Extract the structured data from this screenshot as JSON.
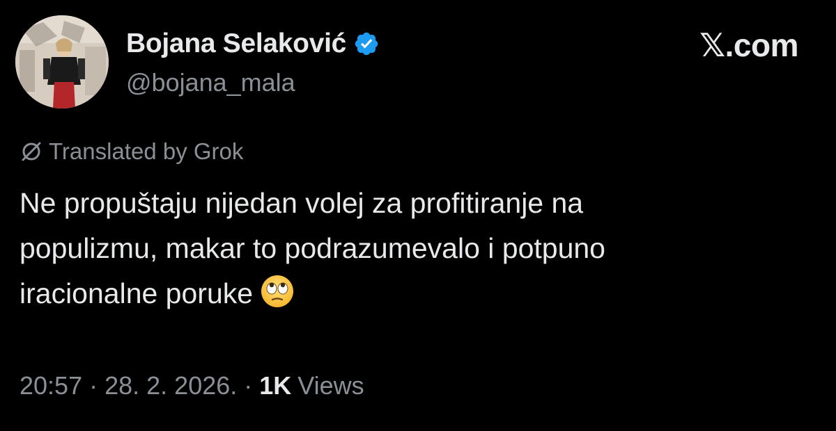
{
  "site_mark": "𝕏.com",
  "author": {
    "display_name": "Bojana Selaković",
    "handle": "@bojana_mala",
    "verified": true,
    "badge_color": "#1d9bf0"
  },
  "tweet": {
    "translation_note": "Translated by Grok",
    "lines": [
      "Ne propuštaju nijedan volej za profitiranje na",
      "populizmu, makar to podrazumevalo i potpuno",
      "iracionalne poruke"
    ],
    "emoji": "face-with-rolling-eyes"
  },
  "meta": {
    "time": "20:57",
    "separator": "·",
    "date": "28. 2. 2026.",
    "views_count": "1K",
    "views_label": "Views"
  },
  "colors": {
    "background": "#000000",
    "primary_text": "#e7e9ea",
    "secondary_text": "#8b9096",
    "verified_blue": "#1d9bf0"
  }
}
